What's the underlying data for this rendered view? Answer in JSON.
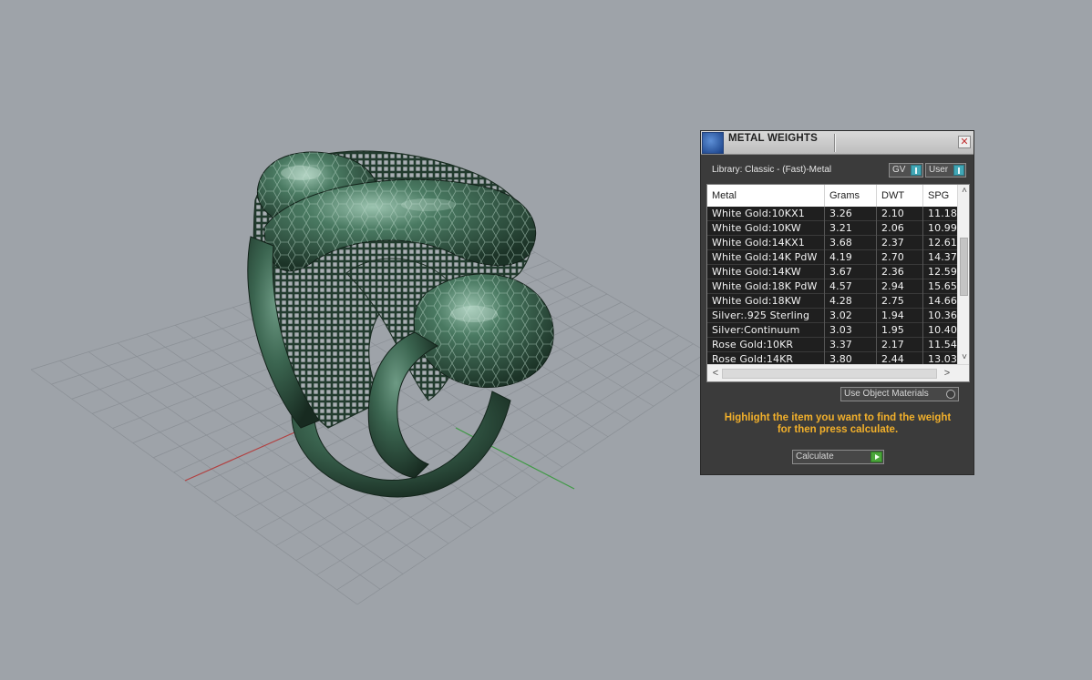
{
  "panel": {
    "title": "METAL WEIGHTS",
    "close_symbol": "✕",
    "library_label": "Library: Classic - (Fast)-Metal",
    "toggle_gv": "GV",
    "toggle_user": "User",
    "columns": [
      "Metal",
      "Grams",
      "DWT",
      "SPG"
    ],
    "rows": [
      [
        "White Gold:10KX1",
        "3.26",
        "2.10",
        "11.18"
      ],
      [
        "White Gold:10KW",
        "3.21",
        "2.06",
        "10.99"
      ],
      [
        "White Gold:14KX1",
        "3.68",
        "2.37",
        "12.61"
      ],
      [
        "White Gold:14K PdW",
        "4.19",
        "2.70",
        "14.37"
      ],
      [
        "White Gold:14KW",
        "3.67",
        "2.36",
        "12.59"
      ],
      [
        "White Gold:18K PdW",
        "4.57",
        "2.94",
        "15.65"
      ],
      [
        "White Gold:18KW",
        "4.28",
        "2.75",
        "14.66"
      ],
      [
        "Silver:.925 Sterling",
        "3.02",
        "1.94",
        "10.36"
      ],
      [
        "Silver:Continuum",
        "3.03",
        "1.95",
        "10.40"
      ],
      [
        "Rose Gold:10KR",
        "3.37",
        "2.17",
        "11.54"
      ],
      [
        "Rose Gold:14KR",
        "3.80",
        "2.44",
        "13.03"
      ]
    ],
    "scroll_up_symbol": "˄",
    "scroll_down_symbol": "˅",
    "scroll_left_symbol": "<",
    "scroll_right_symbol": ">",
    "use_object_materials": "Use Object Materials",
    "instructions_line1": "Highlight the item you want to find the weight",
    "instructions_line2": "for then press calculate.",
    "calculate_label": "Calculate"
  },
  "colors": {
    "background": "#9ea3a9",
    "ring_green": "#3f6a55",
    "panel_bg": "#3b3b3b",
    "instruction_text": "#f2b02b",
    "accent_teal": "#41a7b6",
    "accent_green": "#4aa53a"
  },
  "icons": {
    "app_logo": "rhino-matrix-logo-icon",
    "close": "close-icon",
    "calculate": "play-arrow-icon"
  }
}
